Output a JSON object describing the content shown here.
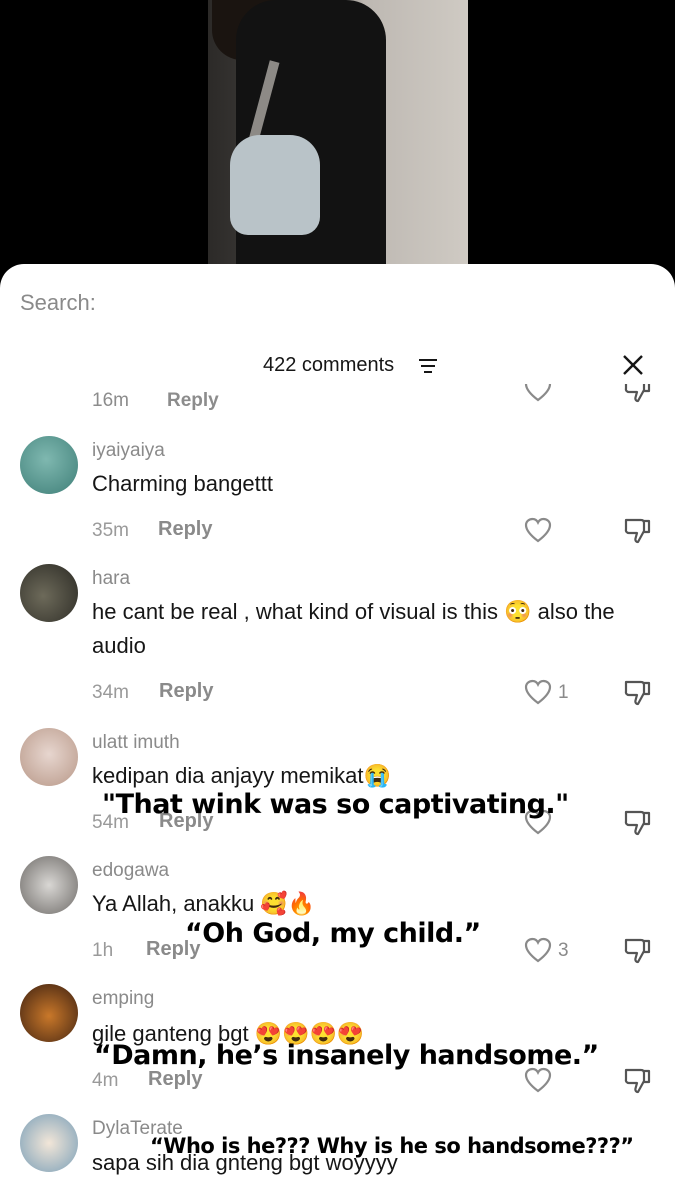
{
  "search": {
    "label": "Search:"
  },
  "header": {
    "comment_count": "422 comments"
  },
  "cutoff_row": {
    "time": "16m",
    "reply": "Reply"
  },
  "comments": [
    {
      "username": "iyaiyaiya",
      "text": "Charming bangettt",
      "time": "35m",
      "reply": "Reply",
      "likes": ""
    },
    {
      "username": "hara",
      "text": "he cant be real , what kind of visual is this 😳 also the audio",
      "time": "34m",
      "reply": "Reply",
      "likes": "1"
    },
    {
      "username": "ulatt imuth",
      "text": "kedipan dia anjayy memikat😭",
      "time": "54m",
      "reply": "Reply",
      "likes": ""
    },
    {
      "username": "edogawa",
      "text": "Ya Allah, anakku 🥰🔥",
      "time": "1h",
      "reply": "Reply",
      "likes": "3"
    },
    {
      "username": "emping",
      "text": "gile ganteng bgt 😍😍😍😍",
      "time": "4m",
      "reply": "Reply",
      "likes": ""
    },
    {
      "username": "DylaTerate",
      "text": "sapa sih dia gnteng bgt woyyyy",
      "time": "",
      "reply": "",
      "likes": ""
    }
  ],
  "translations": {
    "t1": "\"That wink was so captivating.\"",
    "t2": "“Oh God, my child.”",
    "t3": "“Damn, he’s insanely handsome.”",
    "t4": "“Who is he??? Why is he so handsome???”"
  },
  "icons": {
    "like": "heart-outline-icon",
    "dislike": "thumbs-down-icon",
    "close": "close-icon",
    "filter": "filter-lines-icon"
  },
  "colors": {
    "text": "#161616",
    "muted": "#8a8a8a",
    "sheet": "#ffffff",
    "backdrop": "#000000"
  }
}
